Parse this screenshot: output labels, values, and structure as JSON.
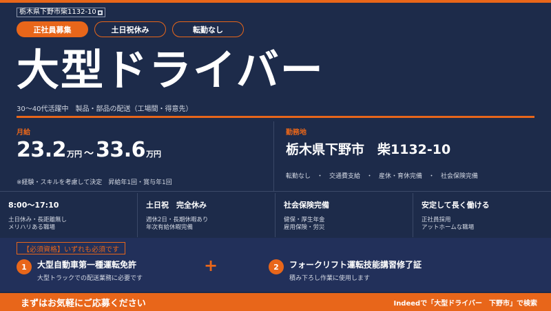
{
  "location_tag": "栃木県下野市柴1132-10",
  "tags": [
    "正社員募集",
    "土日祝休み",
    "転勤なし"
  ],
  "title": "大型ドライバー",
  "subtitle": "30〜40代活躍中　製品・部品の配送（工場間・得意先）",
  "salary": {
    "label": "月給",
    "min": "23.2",
    "max": "33.6",
    "unit": "万円",
    "tilde": "～",
    "note": "※経験・スキルを考慮して決定　昇給年1回・賞与年1回"
  },
  "work": {
    "label": "勤務地",
    "place": "栃木県下野市　柴1132-10",
    "perks": "転勤なし　・　交通費支給　・　産休・育休完備　・　社会保険完備"
  },
  "columns": [
    {
      "title": "8:00〜17:10",
      "desc1": "土日休み・長距離無し",
      "desc2": "メリハリある職場"
    },
    {
      "title": "土日祝　完全休み",
      "desc1": "週休2日・長期休暇あり",
      "desc2": "年次有給休暇完備"
    },
    {
      "title": "社会保険完備",
      "desc1": "健保・厚生年金",
      "desc2": "雇用保険・労災"
    },
    {
      "title": "安定して長く働ける",
      "desc1": "正社員採用",
      "desc2": "アットホームな職場"
    }
  ],
  "requirements": {
    "badge": "【必須資格】いずれも必須です",
    "plus": "+",
    "items": [
      {
        "num": "1",
        "title": "大型自動車第一種運転免許",
        "desc": "大型トラックでの配送業務に必要です"
      },
      {
        "num": "2",
        "title": "フォークリフト運転技能講習修了証",
        "desc": "積み下ろし作業に使用します"
      }
    ]
  },
  "footer": {
    "left": "まずはお気軽にご応募ください",
    "right": "Indeedで「大型ドライバー　下野市」で検索"
  },
  "colors": {
    "accent": "#e8661a",
    "background": "#1d2b4a"
  }
}
